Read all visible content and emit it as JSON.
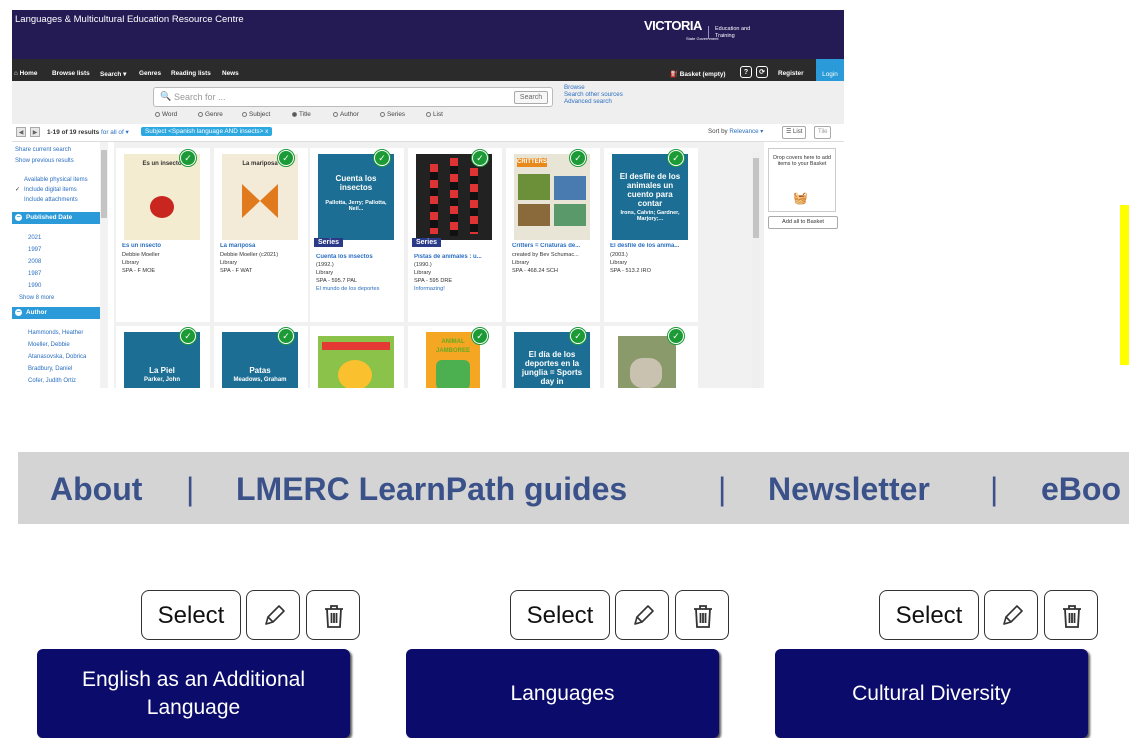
{
  "header": {
    "site_title": "Languages & Multicultural Education Resource Centre",
    "logo_main": "VICTORIA",
    "logo_sub": "State Government",
    "logo_dept": "Education and Training"
  },
  "nav": {
    "home": "Home",
    "browse_lists": "Browse lists",
    "search": "Search ▾",
    "genres": "Genres",
    "reading_lists": "Reading lists",
    "news": "News",
    "basket": "Basket (empty)",
    "help": "?",
    "refresh": "⟳",
    "register": "Register",
    "login": "Login"
  },
  "search": {
    "placeholder": "Search for ...",
    "button": "Search",
    "links": [
      "Browse",
      "Search other sources",
      "Advanced search"
    ],
    "scopes": [
      "Word",
      "Genre",
      "Subject",
      "Title",
      "Author",
      "Series",
      "List"
    ],
    "selected_scope": "Title"
  },
  "results": {
    "count_text": "1-19 of 19 results",
    "for_all": "for all of ▾",
    "subject_chip": "Subject <Spanish language AND insects>  x",
    "sort_label": "Sort by",
    "sort_value": "Relevance ▾",
    "view_list": "☰ List",
    "view_tile": "Tile"
  },
  "sidebar": {
    "share": "Share current search",
    "previous": "Show previous results",
    "physical": "Available physical items",
    "digital": "Include digital items",
    "attachments": "Include attachments",
    "published_head": "Published Date",
    "years": [
      "2021",
      "1997",
      "2008",
      "1987",
      "1990"
    ],
    "show_more": "Show 8 more",
    "author_head": "Author",
    "authors": [
      "Hammonds, Heather",
      "Moeller, Debbie",
      "Atanasovska, Dobrica",
      "Bradbury, Daniel",
      "Cofer, Judith Ortiz"
    ]
  },
  "cards": [
    {
      "title": "Es un insecto",
      "author": "Debbie Moeller",
      "type": "Library",
      "call": "SPA - F MOE",
      "cover_text": "Es un insecto"
    },
    {
      "title": "La mariposa",
      "author": "Debbie Moeller (c2021)",
      "type": "Library",
      "call": "SPA - F WAT",
      "cover_text": "La mariposa"
    },
    {
      "title": "Cuenta los insectos",
      "year": "(1992.)",
      "type": "Library",
      "call": "SPA - 595.7 PAL",
      "series_link": "El mundo de los deportes",
      "cover_text": "Cuenta los insectos",
      "cover_sub": "Pallotta, Jerry; Pallotta, Neil...",
      "series": "Series"
    },
    {
      "title": "Pistas de animales : u...",
      "year": "(1990.)",
      "type": "Library",
      "call": "SPA - 595 DRE",
      "series_link": "Informazing!",
      "series": "Series"
    },
    {
      "title": "Critters = Criaturas de...",
      "author": "created by Bev Schumac...",
      "type": "Library",
      "call": "SPA - 468.24 SCH",
      "cover_text": "CRITTERS"
    },
    {
      "title": "El desfile de los anima...",
      "year": "(2003.)",
      "type": "Library",
      "call": "SPA - 513.2 IRO",
      "cover_text": "El desfile de los animales un cuento para contar",
      "cover_sub": "Irons, Calvin; Gardner, Marjory;..."
    }
  ],
  "cards_row2": [
    {
      "cover_text": "La Piel",
      "cover_sub": "Parker, John"
    },
    {
      "cover_text": "Patas",
      "cover_sub": "Meadows, Graham"
    },
    {
      "cover_text": ""
    },
    {
      "cover_text": "ANIMAL JAMBOREE"
    },
    {
      "cover_text": "El día de los deportes en la junglia = Sports day in"
    },
    {
      "cover_text": ""
    }
  ],
  "basket_panel": {
    "drop_text": "Drop covers here to add items to your Basket",
    "add_all": "Add all to Basket"
  },
  "linkbar": {
    "items": [
      "About",
      "LMERC LearnPath guides",
      "Newsletter",
      "eBoo"
    ],
    "separator": "|"
  },
  "categories": [
    {
      "select": "Select",
      "label": "English as an Additional Language"
    },
    {
      "select": "Select",
      "label": "Languages"
    },
    {
      "select": "Select",
      "label": "Cultural Diversity"
    }
  ],
  "colors": {
    "header_bg": "#241b55",
    "accent": "#2b9ad8",
    "tile_bg": "#0b0b6b",
    "link": "#3a5189",
    "check": "#1c9a36"
  }
}
